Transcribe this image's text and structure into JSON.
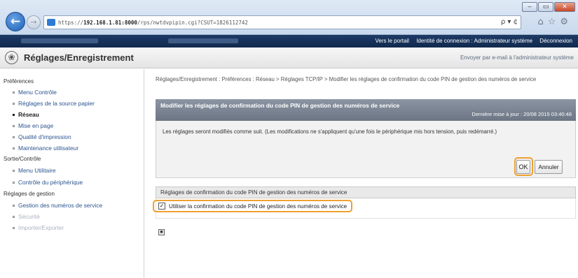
{
  "browser": {
    "url_prefix": "https://",
    "url_host": "192.168.1.81:8000",
    "url_path": "/rps/nwtdvpipin.cgi?CSUT=1826112742",
    "address_tools": "ρ ▾ ¢",
    "window_buttons": [
      "‒",
      "▭",
      "✕"
    ]
  },
  "topbar": {
    "links": [
      "Vers le portail",
      "Identité de connexion : Administrateur système",
      "Déconnexion"
    ]
  },
  "header": {
    "title": "Réglages/Enregistrement",
    "email_link": "Envoyer par e-mail à l'administrateur système"
  },
  "sidebar": {
    "sections": [
      {
        "title": "Préférences",
        "items": [
          {
            "label": "Menu Contrôle"
          },
          {
            "label": "Réglages de la source papier"
          },
          {
            "label": "Réseau",
            "active": true
          },
          {
            "label": "Mise en page"
          },
          {
            "label": "Qualité d'impression"
          },
          {
            "label": "Maintenance utilisateur"
          }
        ]
      },
      {
        "title": "Sortie/Contrôle",
        "items": [
          {
            "label": "Menu Utilitaire"
          },
          {
            "label": "Contrôle du périphérique"
          }
        ]
      },
      {
        "title": "Réglages de gestion",
        "items": [
          {
            "label": "Gestion des numéros de service"
          },
          {
            "label": "Sécurité"
          },
          {
            "label": "Importer/Exporter"
          }
        ]
      }
    ]
  },
  "main": {
    "breadcrumb": "Réglages/Enregistrement : Préférences : Réseau > Réglages TCP/IP > Modifier les réglages de confirmation du code PIN de gestion des numéros de service",
    "panel_title": "Modifier les réglages de confirmation du code PIN de gestion des numéros de service",
    "last_update": "Dernière mise à jour : 20/08 2015 03:40:48",
    "message": "Les réglages seront modifiés comme suit. (Les modifications ne s'appliquent qu'une fois le périphérique mis hors tension, puis redémarré.)",
    "ok_label": "OK",
    "cancel_label": "Annuler",
    "section_title": "Réglages de confirmation du code PIN de gestion des numéros de service",
    "checkbox_label": "Utiliser la confirmation du code PIN de gestion des numéros de service",
    "checkbox_checked": true
  },
  "colors": {
    "highlight": "#f0a030",
    "topbar": "#1d3a66",
    "panel_header": "#7a8492"
  }
}
